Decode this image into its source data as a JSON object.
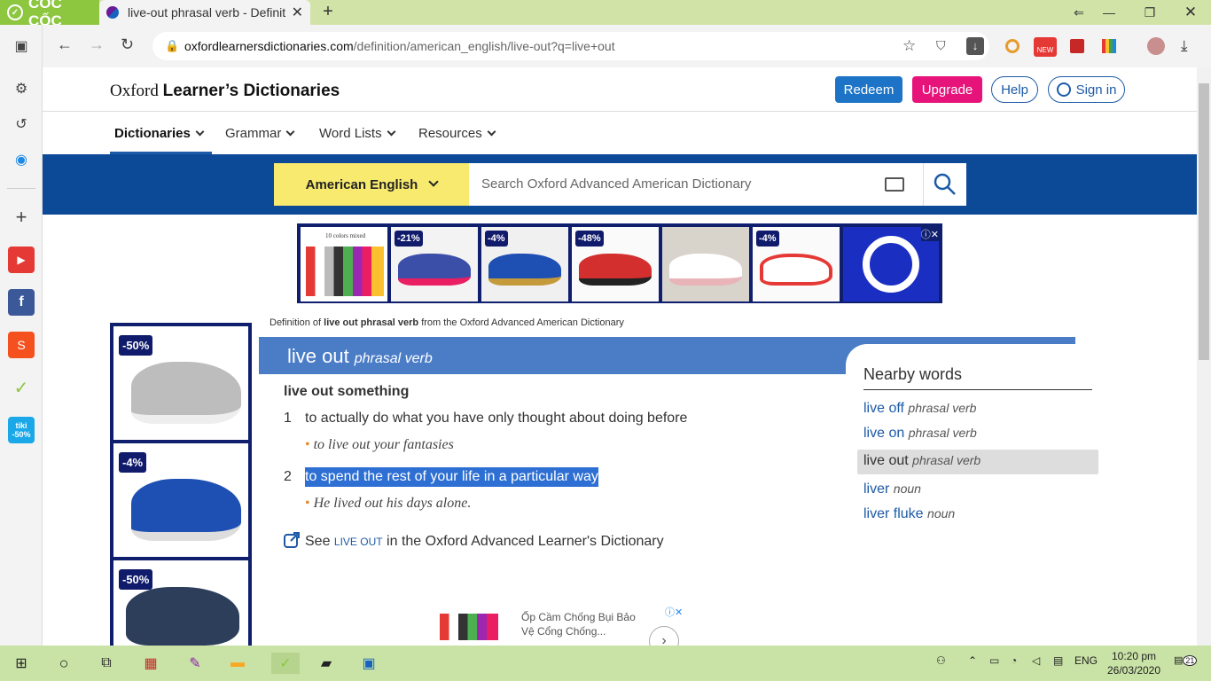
{
  "browser": {
    "brand": "CỐC CỐC",
    "tab_title": "live-out phrasal verb - Definit",
    "url_main": "oxfordlearnersdictionaries.com",
    "url_path": "/definition/american_english/live-out?q=live+out"
  },
  "site": {
    "brand_serif": "Oxford",
    "brand_bold": "Learner’s Dictionaries",
    "redeem": "Redeem",
    "upgrade": "Upgrade",
    "help": "Help",
    "signin": "Sign in",
    "menu": [
      "Dictionaries",
      "Grammar",
      "Word Lists",
      "Resources"
    ],
    "dict_select": "American English",
    "search_placeholder": "Search Oxford Advanced American Dictionary"
  },
  "ads": {
    "top_badges": [
      "-21%",
      "-4%",
      "-48%",
      "-4%"
    ],
    "top_caption": "10 colors mixed",
    "side_badges": [
      "-50%",
      "-4%",
      "-50%"
    ],
    "bottom_text": "Ốp Cầm Chống Bụi Bảo Vệ Cổng Chống..."
  },
  "entry": {
    "source_prefix": "Definition of ",
    "source_bold": "live out phrasal verb",
    "source_suffix": " from the Oxford Advanced American Dictionary",
    "headword": "live out",
    "pos": "phrasal verb",
    "pattern": "live out something",
    "senses": [
      {
        "num": "1",
        "def": "to actually do what you have only thought about doing before",
        "example": "to live out your fantasies"
      },
      {
        "num": "2",
        "def": "to spend the rest of your life in a particular way",
        "example": "He lived out his days alone."
      }
    ],
    "see_prefix": "See ",
    "see_link": "LIVE OUT",
    "see_suffix": " in the Oxford Advanced Learner's Dictionary"
  },
  "nearby": {
    "heading": "Nearby words",
    "words": [
      {
        "word": "live off",
        "pos": "phrasal verb"
      },
      {
        "word": "live on",
        "pos": "phrasal verb"
      },
      {
        "word": "live out",
        "pos": "phrasal verb"
      },
      {
        "word": "liver",
        "pos": "noun"
      },
      {
        "word": "liver fluke",
        "pos": "noun"
      }
    ]
  },
  "taskbar": {
    "lang": "ENG",
    "time": "10:20 pm",
    "date": "26/03/2020",
    "notif": "21"
  }
}
